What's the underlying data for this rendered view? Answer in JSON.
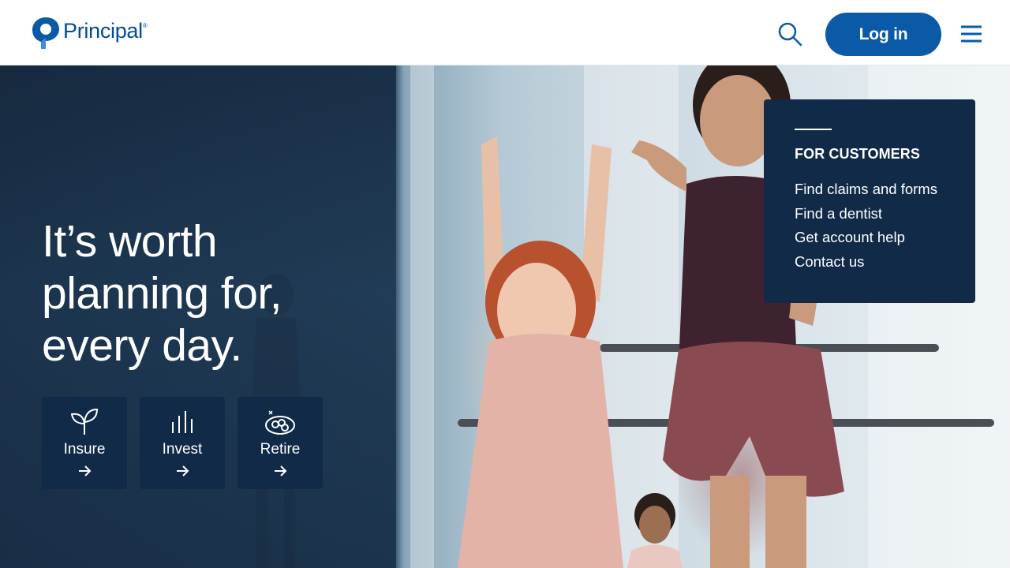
{
  "brand": {
    "name": "Principal",
    "reg_mark": "®",
    "logo_icon": "principal-p-icon",
    "color": "#004c97"
  },
  "header": {
    "search_icon": "search-icon",
    "login_label": "Log in",
    "menu_icon": "hamburger-menu-icon",
    "accent_color": "#0a5aa8"
  },
  "hero": {
    "headline": "It’s worth planning for, every day.",
    "tiles": [
      {
        "label": "Insure",
        "icon": "sprout-icon",
        "arrow_icon": "arrow-right-icon"
      },
      {
        "label": "Invest",
        "icon": "bar-chart-icon",
        "arrow_icon": "arrow-right-icon"
      },
      {
        "label": "Retire",
        "icon": "nest-icon",
        "arrow_icon": "arrow-right-icon"
      }
    ],
    "panel": {
      "title": "FOR CUSTOMERS",
      "links": [
        "Find claims and forms",
        "Find a dentist",
        "Get account help",
        "Contact us"
      ]
    },
    "panel_color": "#102a48"
  }
}
